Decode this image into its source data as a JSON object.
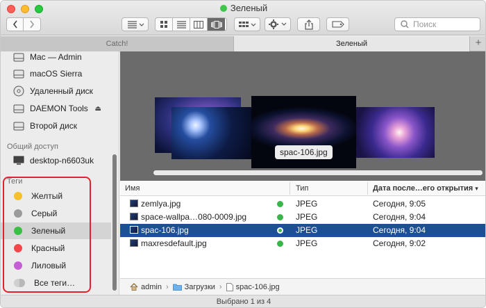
{
  "window": {
    "title": "Зеленый",
    "title_tag_color": "#3fc54b"
  },
  "toolbar": {
    "search_placeholder": "Поиск"
  },
  "tabs": [
    {
      "label": "Catch!"
    },
    {
      "label": "Зеленый"
    }
  ],
  "sidebar": {
    "devices": [
      {
        "label": "Mac — Admin",
        "icon": "hard-disk-icon"
      },
      {
        "label": "macOS Sierra",
        "icon": "hard-disk-icon"
      },
      {
        "label": "Удаленный диск",
        "icon": "optical-disc-icon"
      },
      {
        "label": "DAEMON Tools",
        "icon": "hard-disk-icon",
        "eject": true
      },
      {
        "label": "Второй диск",
        "icon": "hard-disk-icon"
      }
    ],
    "shared_header": "Общий доступ",
    "shared": [
      {
        "label": "desktop-n6603uk",
        "icon": "monitor-icon"
      }
    ],
    "tags_header": "Теги",
    "tags": [
      {
        "label": "Желтый",
        "color": "#f5c02a"
      },
      {
        "label": "Серый",
        "color": "#9b9b9b"
      },
      {
        "label": "Зеленый",
        "color": "#3cbf46",
        "selected": true
      },
      {
        "label": "Красный",
        "color": "#f5474b"
      },
      {
        "label": "Лиловый",
        "color": "#c45ed6"
      },
      {
        "label": "Все теги…",
        "color": "#cfcfcf"
      }
    ]
  },
  "cover_flow": {
    "caption": "spac-106.jpg"
  },
  "file_list": {
    "columns": {
      "name": "Имя",
      "type": "Тип",
      "date": "Дата после…его открытия"
    },
    "rows": [
      {
        "name": "zemlya.jpg",
        "type": "JPEG",
        "date": "Сегодня, 9:05",
        "selected": false
      },
      {
        "name": "space-wallpa…080-0009.jpg",
        "type": "JPEG",
        "date": "Сегодня, 9:04",
        "selected": false
      },
      {
        "name": "spac-106.jpg",
        "type": "JPEG",
        "date": "Сегодня, 9:04",
        "selected": true
      },
      {
        "name": "maxresdefault.jpg",
        "type": "JPEG",
        "date": "Сегодня, 9:02",
        "selected": false
      }
    ]
  },
  "path_bar": [
    "admin",
    "Загрузки",
    "spac-106.jpg"
  ],
  "status": {
    "text": "Выбрано 1 из 4"
  }
}
